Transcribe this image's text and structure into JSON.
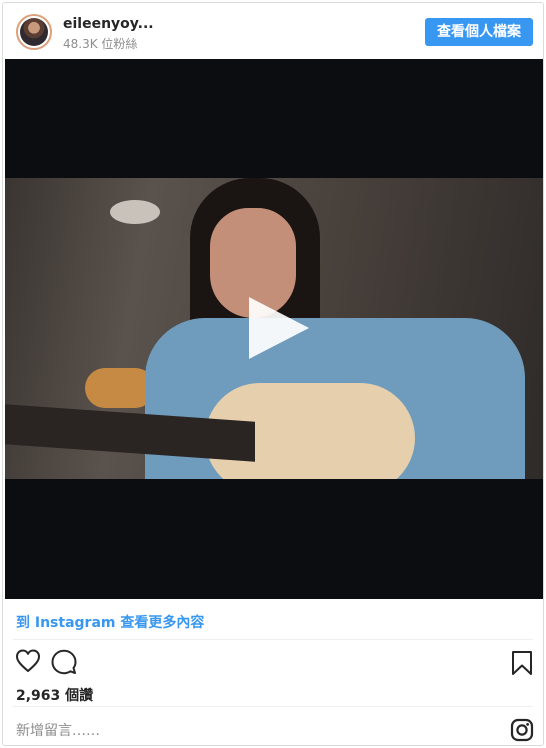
{
  "header": {
    "username": "eileenyoy...",
    "followers": "48.3K 位粉絲",
    "profile_button": "查看個人檔案"
  },
  "media": {
    "type": "video",
    "play_icon": "play-icon"
  },
  "footer": {
    "more_link": "到 Instagram 查看更多內容",
    "views": "2,963 個讚",
    "comment_placeholder": "新增留言……",
    "icons": [
      "heart-icon",
      "comment-icon",
      "bookmark-icon",
      "instagram-icon"
    ]
  }
}
